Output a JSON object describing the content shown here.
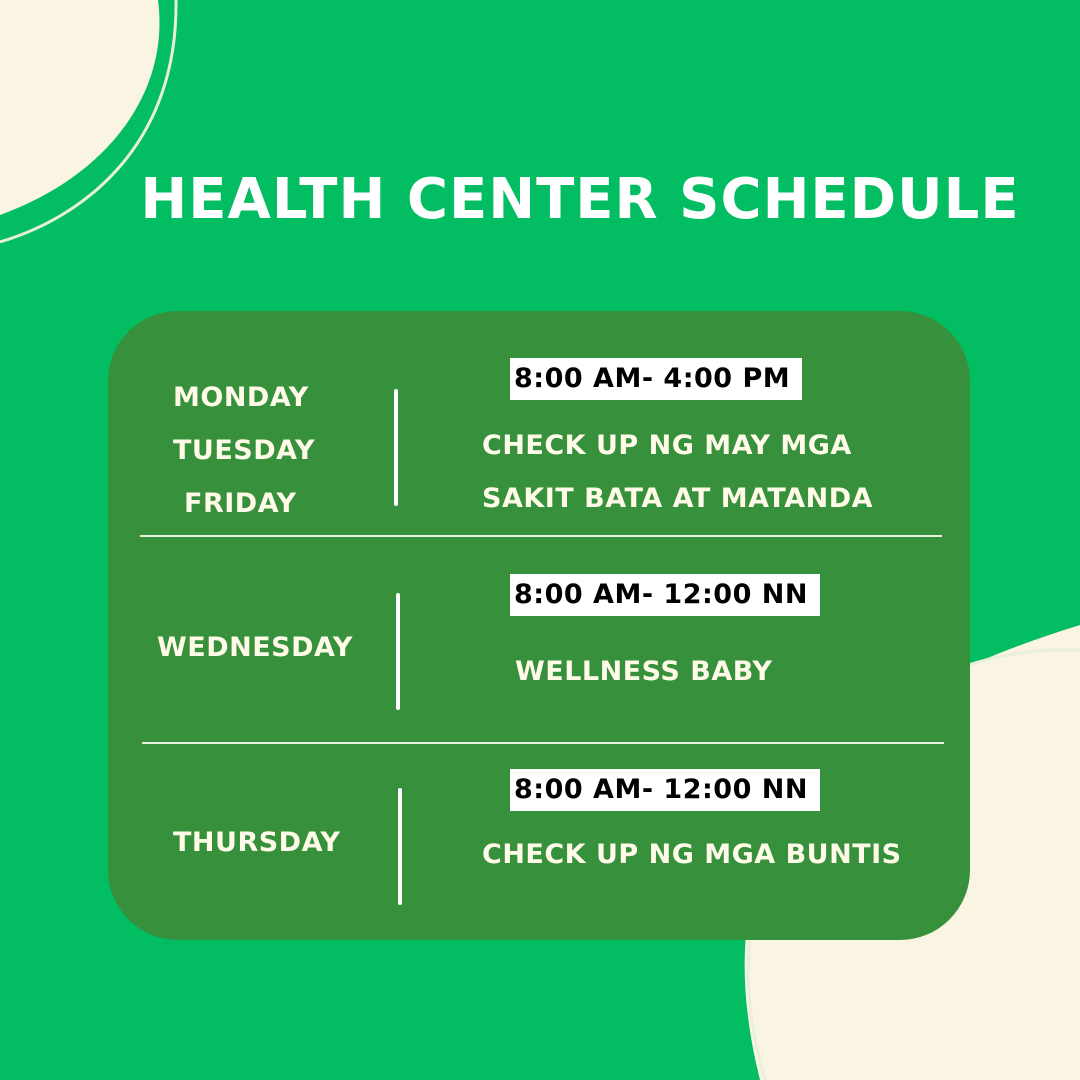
{
  "title": "HEALTH CENTER SCHEDULE",
  "colors": {
    "background": "#02bd61",
    "card": "#36903c",
    "blob": "#faf4e2",
    "time_badge": "#ffffff",
    "text": "#fffbe8"
  },
  "schedule": [
    {
      "days": [
        "MONDAY",
        "TUESDAY",
        "FRIDAY"
      ],
      "time": "8:00 AM- 4:00 PM",
      "description": [
        "CHECK UP NG MAY MGA",
        "SAKIT BATA AT MATANDA"
      ]
    },
    {
      "days": [
        "WEDNESDAY"
      ],
      "time": "8:00 AM- 12:00 NN",
      "description": [
        "WELLNESS BABY"
      ]
    },
    {
      "days": [
        "THURSDAY"
      ],
      "time": "8:00 AM- 12:00 NN",
      "description": [
        "CHECK UP NG MGA BUNTIS"
      ]
    }
  ]
}
